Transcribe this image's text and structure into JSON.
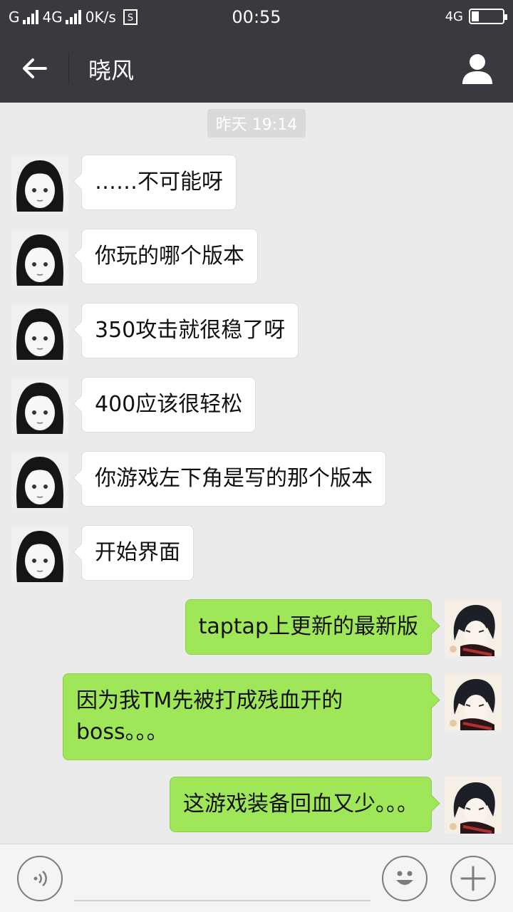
{
  "status_bar": {
    "carrier1": "G",
    "carrier2": "4G",
    "speed": "0K/s",
    "time": "00:55",
    "network_right": "4G"
  },
  "header": {
    "title": "晓风",
    "back_icon": "arrow-left-icon",
    "profile_icon": "person-icon"
  },
  "chat": {
    "timestamp": "昨天 19:14",
    "messages": [
      {
        "side": "in",
        "text": "……不可能呀"
      },
      {
        "side": "in",
        "text": "你玩的哪个版本"
      },
      {
        "side": "in",
        "text": "350攻击就很稳了呀"
      },
      {
        "side": "in",
        "text": "400应该很轻松"
      },
      {
        "side": "in",
        "text": "你游戏左下角是写的那个版本"
      },
      {
        "side": "in",
        "text": "开始界面"
      },
      {
        "side": "out",
        "text": "taptap上更新的最新版"
      },
      {
        "side": "out",
        "text": "因为我TM先被打成残血开的boss。。。"
      },
      {
        "side": "out",
        "text": "这游戏装备回血又少。。。"
      }
    ]
  },
  "input_bar": {
    "voice_icon": "voice-icon",
    "emoji_icon": "smiley-icon",
    "plus_icon": "plus-icon"
  },
  "colors": {
    "header_bg": "#393a3f",
    "chat_bg": "#ebebeb",
    "outgoing_bubble": "#9fe658",
    "incoming_bubble": "#ffffff"
  }
}
